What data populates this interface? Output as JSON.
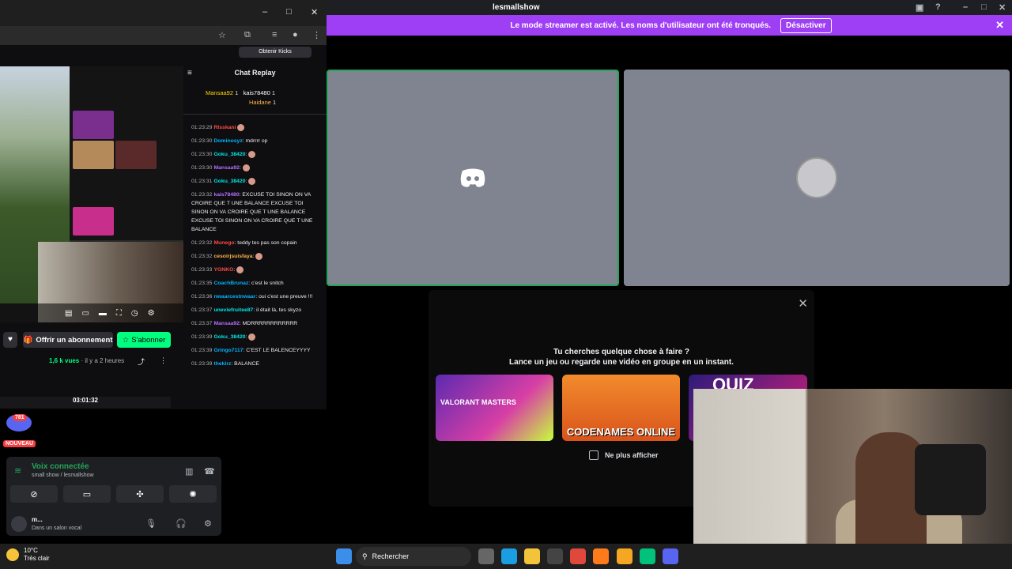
{
  "discord": {
    "title": "lesmallshow",
    "banner": {
      "text": "Le mode streamer est activé. Les noms d'utilisateur ont été tronqués.",
      "button": "Désactiver"
    },
    "activity": {
      "line1": "Tu cherches quelque chose à faire ?",
      "line2": "Lance un jeu ou regarde une vidéo en groupe en un instant.",
      "cards": [
        "VALORANT MASTERS",
        "CODENAMES ONLINE",
        "QUIZ"
      ],
      "checkbox": "Ne plus afficher"
    },
    "badge_count": "781",
    "new_label": "NOUVEAU",
    "voice": {
      "status": "Voix connectée",
      "channel": "small show / lesmallshow"
    },
    "user": {
      "name": "m...",
      "status": "Dans un salon vocal"
    }
  },
  "twitch": {
    "top_button": "Obtenir Kicks",
    "gift_label": "Offrir un abonnement",
    "subscribe_label": "S'abonner",
    "views": "1,6 k vues",
    "ago": "il y a 2 heures",
    "timestamp": "03:01:32",
    "chat": {
      "header": "Chat Replay",
      "podium": [
        "Mansaa92",
        "kais78480",
        "Haidane"
      ],
      "podium_counts": [
        "1",
        "1",
        "1"
      ],
      "messages": [
        {
          "t": "01:23:29",
          "u": "Rlsskani",
          "c": "#ff4a4a",
          "m": ""
        },
        {
          "t": "01:23:30",
          "u": "Dominosyz",
          "c": "#00b5ff",
          "m": ": mdrrrr op"
        },
        {
          "t": "01:23:30",
          "u": "Goku_38420",
          "c": "#00e6e6",
          "m": ":"
        },
        {
          "t": "01:23:30",
          "u": "Mansaa92",
          "c": "#b66dff",
          "m": ":"
        },
        {
          "t": "01:23:31",
          "u": "Goku_38420",
          "c": "#00e6e6",
          "m": ":"
        },
        {
          "t": "01:23:32",
          "u": "kais78480",
          "c": "#b66dff",
          "m": ": EXCUSE TOI SINON ON VA CROIRE QUE T UNE BALANCE EXCUSE TOI SINON ON VA CROIRE QUE T UNE BALANCE EXCUSE TOI SINON ON VA CROIRE QUE T UNE BALANCE"
        },
        {
          "t": "01:23:32",
          "u": "Munego",
          "c": "#ff4a4a",
          "m": ": teddy tes pas son copain"
        },
        {
          "t": "01:23:32",
          "u": "cesoirjsuisfaya",
          "c": "#ffb347",
          "m": ":"
        },
        {
          "t": "01:23:33",
          "u": "YGNKO",
          "c": "#ff4a4a",
          "m": ":"
        },
        {
          "t": "01:23:35",
          "u": "CoachBrunaz",
          "c": "#00b5ff",
          "m": ": c'est le snitch"
        },
        {
          "t": "01:23:36",
          "u": "nwaarcestnwaar",
          "c": "#00b5ff",
          "m": ": oui c'est une preuve !!!"
        },
        {
          "t": "01:23:37",
          "u": "uneviefruitee87",
          "c": "#00e6e6",
          "m": ": il était là, tes skyzo"
        },
        {
          "t": "01:23:37",
          "u": "Mansaa92",
          "c": "#b66dff",
          "m": ": MDRRRRRRRRRRRR"
        },
        {
          "t": "01:23:39",
          "u": "Goku_38420",
          "c": "#00e6e6",
          "m": ":"
        },
        {
          "t": "01:23:39",
          "u": "Gringo7117",
          "c": "#00b5ff",
          "m": ": C'EST LE BALENCEYYYY"
        },
        {
          "t": "01:23:39",
          "u": "thekirz",
          "c": "#00b5ff",
          "m": ": BALANCE"
        }
      ]
    }
  },
  "taskbar": {
    "temp": "10°C",
    "weather": "Très clair",
    "search": "Rechercher"
  },
  "colors": {
    "accent": "#9f3ff5",
    "twitch_green": "#00ff7f",
    "discord_green": "#23a55a"
  }
}
